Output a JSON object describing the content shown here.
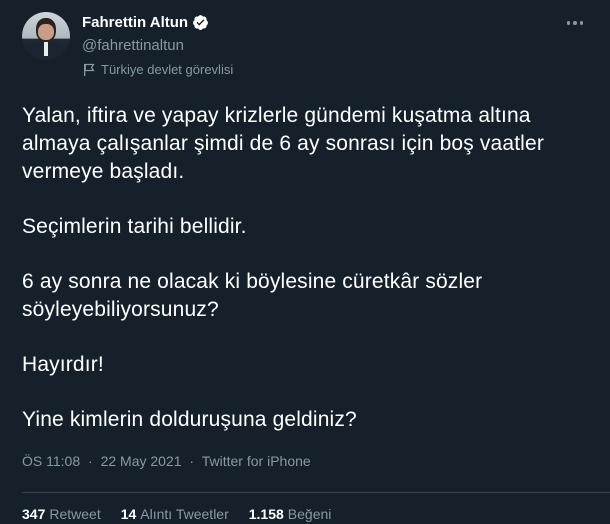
{
  "author": {
    "name": "Fahrettin Altun",
    "handle": "@fahrettinaltun",
    "label": "Türkiye devlet görevlisi",
    "verified_color": "#ffffff"
  },
  "tweet": {
    "paragraphs": [
      "Yalan, iftira ve yapay krizlerle gündemi kuşatma altına almaya çalışanlar şimdi de 6 ay sonrası için boş vaatler vermeye başladı.",
      "Seçimlerin tarihi bellidir.",
      "6 ay sonra ne olacak ki böylesine cüretkâr sözler söyleyebiliyorsunuz?",
      "Hayırdır!",
      "Yine kimlerin dolduruşuna geldiniz?"
    ],
    "time": "ÖS 11:08",
    "separator": "·",
    "date": "22 May 2021",
    "source": "Twitter for iPhone"
  },
  "stats": {
    "retweets_count": "347",
    "retweets_label": "Retweet",
    "quotes_count": "14",
    "quotes_label": "Alıntı Tweetler",
    "likes_count": "1.158",
    "likes_label": "Beğeni"
  },
  "icons": {
    "more": "more-dots-icon",
    "verified": "verified-badge-icon",
    "label": "flag-icon"
  },
  "colors": {
    "background": "#15202b",
    "secondary_text": "#8899a6",
    "divider": "#38444d"
  }
}
